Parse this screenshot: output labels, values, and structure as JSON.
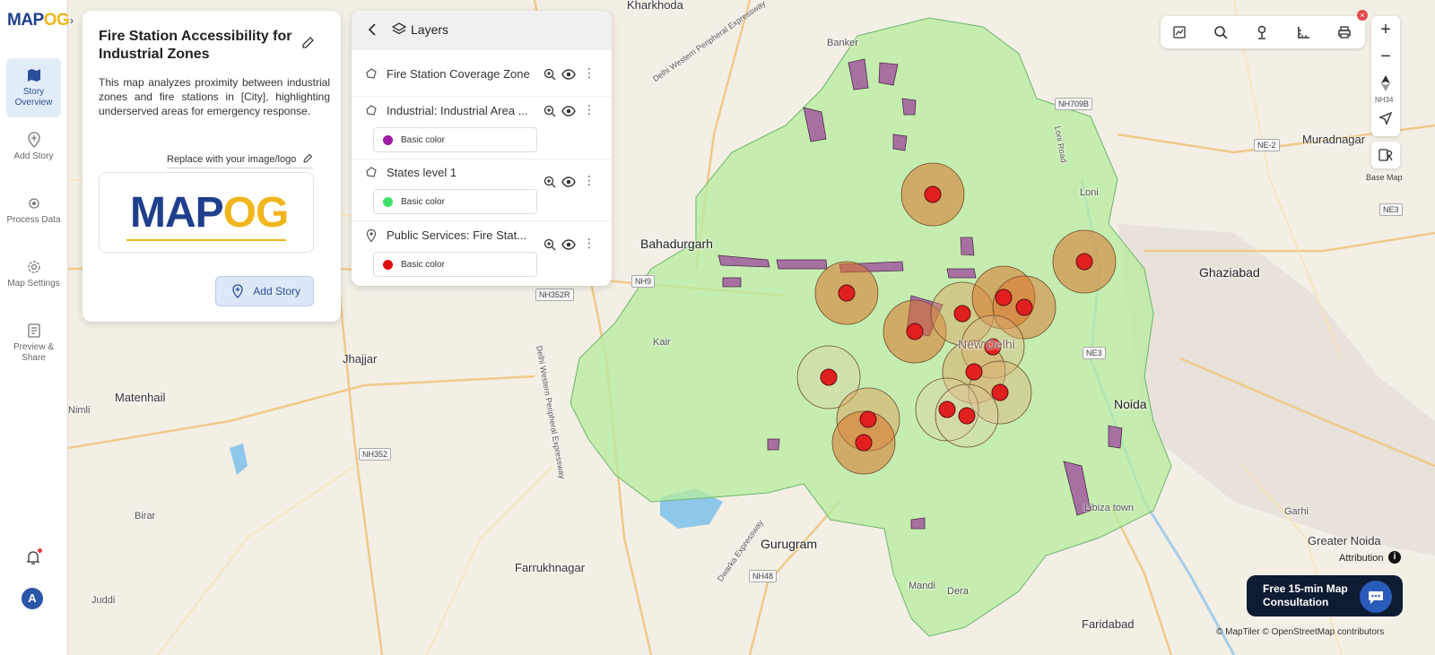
{
  "rail": {
    "logo_a": "MAP",
    "logo_b": "OG",
    "collapse": "›",
    "items": [
      {
        "label": "Story Overview",
        "icon": "map-book-icon"
      },
      {
        "label": "Add Story",
        "icon": "add-pin-icon"
      },
      {
        "label": "Process Data",
        "icon": "process-gear-icon"
      },
      {
        "label": "Map Settings",
        "icon": "settings-gear-icon"
      },
      {
        "label": "Preview & Share",
        "icon": "preview-list-icon"
      }
    ],
    "avatar": "A"
  },
  "story": {
    "title": "Fire Station Accessibility for Industrial Zones",
    "description": "This map analyzes proximity between industrial zones and fire stations in [City], highlighting underserved areas for emergency response.",
    "replace_link": "Replace with your image/logo",
    "logo_a": "MAP",
    "logo_b": "OG",
    "add_button": "Add Story"
  },
  "layers": {
    "title": "Layers",
    "items": [
      {
        "name": "Fire Station Coverage Zone",
        "chip": null,
        "icon": "polygon-icon"
      },
      {
        "name": "Industrial: Industrial Area ...",
        "chip": "Basic color",
        "color": "#9c1aa6",
        "icon": "polygon-icon"
      },
      {
        "name": "States level 1",
        "chip": "Basic color",
        "color": "#3ee06a",
        "icon": "polygon-icon"
      },
      {
        "name": "Public Services: Fire Stat...",
        "chip": "Basic color",
        "color": "#e01010",
        "icon": "point-icon"
      }
    ]
  },
  "map": {
    "labels": {
      "kharkhoda": "Kharkhoda",
      "banker": "Banker",
      "bahadurgarh": "Bahadurgarh",
      "jhajjar": "Jhajjar",
      "matenhail": "Matenhail",
      "nimli": "Nimli",
      "birar": "Birar",
      "farrukhnagar": "Farrukhnagar",
      "juddi": "Juddi",
      "gurugram": "Gurugram",
      "mandi": "Mandi",
      "dera": "Dera",
      "faridabad": "Faridabad",
      "noida": "Noida",
      "ghaziabad": "Ghaziabad",
      "loni": "Loni",
      "muradnagar": "Muradnagar",
      "greater_noida": "Greater Noida",
      "garhi": "Garhi",
      "libiza": "Libiza town",
      "kair": "Kair",
      "new_delhi": "New Delhi",
      "loni_road": "Loni Road",
      "dwe1": "Delhi Western Peripheral Expressway",
      "dwe2": "Delhi Western Peripheral Expressway",
      "dwarka": "Dwarka Expressway"
    },
    "shields": {
      "nh709b": "NH709B",
      "ne2": "NE-2",
      "nh9": "NH9",
      "nh352r": "NH352R",
      "nh352": "NH352",
      "nh48": "NH48",
      "ne3a": "NE3",
      "ne3b": "NE3"
    }
  },
  "controls": {
    "zoom_in": "+",
    "zoom_out": "−",
    "compass": "▲",
    "nh34": "NH34",
    "basemap": "Base Map",
    "close": "×"
  },
  "attribution": "Attribution",
  "consult": {
    "line1": "Free 15-min Map",
    "line2": "Consultation"
  },
  "copyright": "© MapTiler © OpenStreetMap contributors",
  "colors": {
    "accent": "#2a4f9a",
    "industrial": "#9c1aa6",
    "state": "#3ee06a",
    "fire_station": "#e01010",
    "coverage": "#d9742b"
  }
}
